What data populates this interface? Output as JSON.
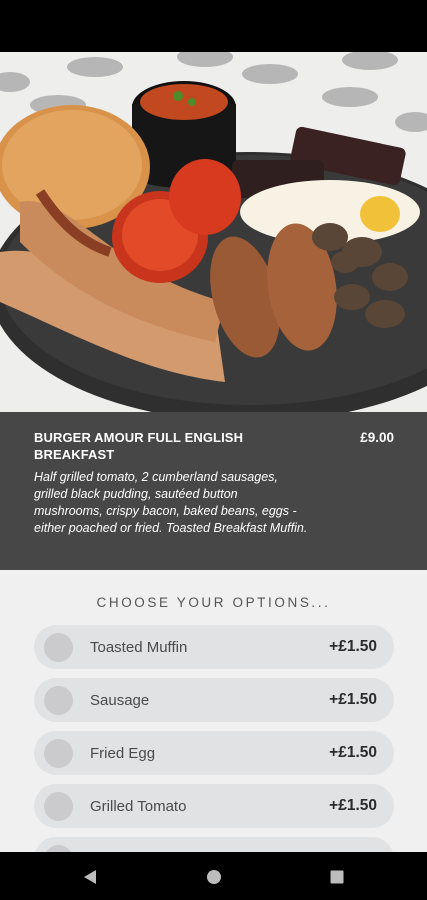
{
  "item": {
    "title": "BURGER AMOUR FULL ENGLISH BREAKFAST",
    "price": "£9.00",
    "description": "Half grilled tomato, 2 cumberland sausages, grilled black pudding, sautéed button mushrooms, crispy bacon, baked beans, eggs - either poached or fried. Toasted Breakfast Muffin."
  },
  "options": {
    "heading": "CHOOSE YOUR OPTIONS...",
    "items": [
      {
        "label": "Toasted Muffin",
        "price": "+£1.50",
        "selected": false
      },
      {
        "label": "Sausage",
        "price": "+£1.50",
        "selected": false
      },
      {
        "label": "Fried Egg",
        "price": "+£1.50",
        "selected": false
      },
      {
        "label": "Grilled Tomato",
        "price": "+£1.50",
        "selected": false
      }
    ]
  },
  "nav": {
    "icons": [
      "back-icon",
      "home-icon",
      "recents-icon"
    ]
  },
  "colors": {
    "panel": "#474747",
    "option_bg": "#e1e2e4",
    "radio": "#cbcbcd",
    "page_bg": "#f0f0f0"
  }
}
